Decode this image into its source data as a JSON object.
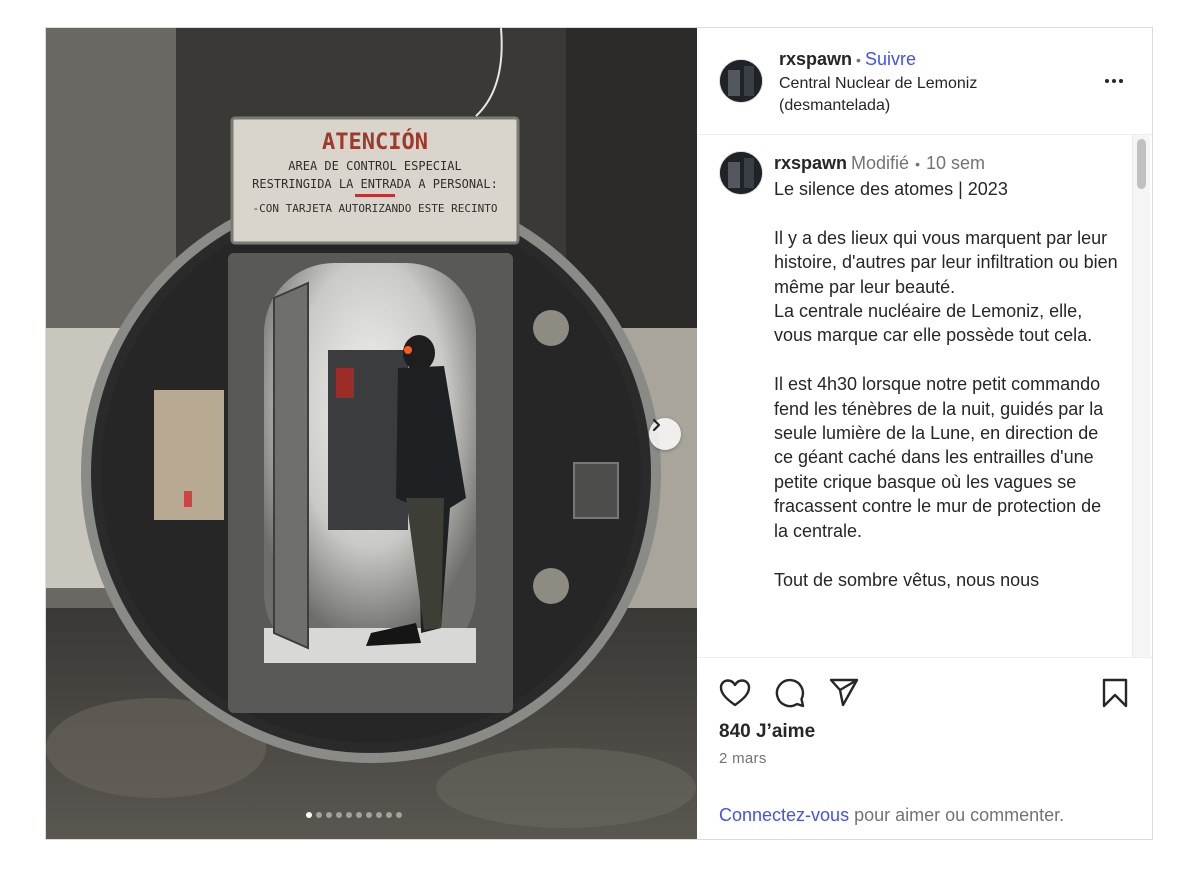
{
  "post": {
    "username": "rxspawn",
    "separator": "•",
    "follow_label": "Suivre",
    "location": "Central Nuclear de Lemoniz (desmantelada)",
    "image": {
      "sign_lines": [
        "ATENCIÓN",
        "AREA DE CONTROL ESPECIAL",
        "RESTRINGIDA LA ENTRADA A PERSONAL:",
        "-CON TARJETA AUTORIZANDO  ESTE RECINTO"
      ],
      "carousel_count": 10,
      "carousel_active": 1
    },
    "comment": {
      "username": "rxspawn",
      "edited_label": "Modifié",
      "separator": "•",
      "time": "10 sem",
      "caption": "Le silence des atomes | 2023\n\nIl y a des lieux qui vous marquent par leur histoire, d'autres par leur infiltration ou bien même par leur beauté.\nLa centrale nucléaire de Lemoniz, elle, vous marque car elle possède tout cela.\n\nIl est 4h30 lorsque notre petit commando fend les ténèbres de la nuit, guidés par la seule lumière de la Lune, en direction de ce géant caché dans les entrailles d'une petite crique basque où les vagues se fracassent contre le mur de protection de la centrale.\n\nTout de sombre vêtus, nous nous"
    },
    "likes": "840 J’aime",
    "date": "2 mars",
    "login_link": "Connectez-vous",
    "login_rest": " pour aimer ou commenter."
  },
  "icons": [
    "heart-icon",
    "comment-icon",
    "share-icon",
    "bookmark-icon",
    "more-icon",
    "chevron-right-icon"
  ],
  "colors": {
    "link": "#4150f7",
    "muted": "#737373",
    "text": "#262626",
    "border": "#dbdbdb"
  }
}
